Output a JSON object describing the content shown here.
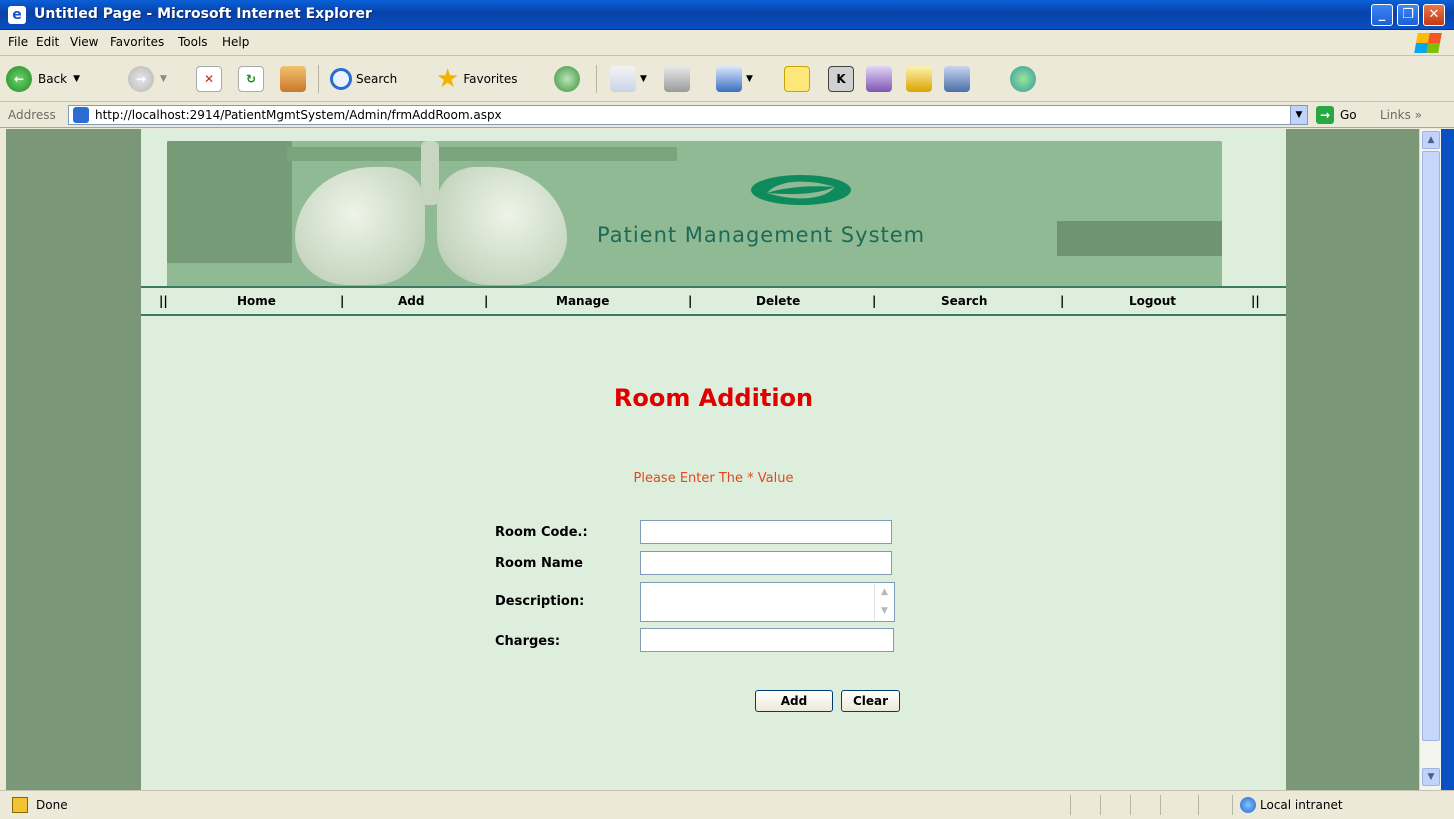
{
  "window": {
    "title": "Untitled Page - Microsoft Internet Explorer"
  },
  "menu": [
    "File",
    "Edit",
    "View",
    "Favorites",
    "Tools",
    "Help"
  ],
  "toolbar": {
    "back_label": "Back",
    "search_label": "Search",
    "favorites_label": "Favorites"
  },
  "address": {
    "label": "Address",
    "url": "http://localhost:2914/PatientMgmtSystem/Admin/frmAddRoom.aspx",
    "go_label": "Go",
    "links_label": "Links"
  },
  "banner": {
    "title": "Patient Management System"
  },
  "nav": {
    "sep_start": "||",
    "home": "Home",
    "add": "Add",
    "manage": "Manage",
    "delete": "Delete",
    "search": "Search",
    "logout": "Logout",
    "sep": "|",
    "sep_end": "||"
  },
  "page": {
    "heading": "Room Addition",
    "notice": "Please Enter The * Value",
    "fields": {
      "room_code": {
        "label": "Room Code.:",
        "value": ""
      },
      "room_name": {
        "label": "Room Name",
        "value": ""
      },
      "description": {
        "label": "Description:",
        "value": ""
      },
      "charges": {
        "label": "Charges:",
        "value": ""
      }
    },
    "buttons": {
      "add": "Add",
      "clear": "Clear"
    }
  },
  "status": {
    "text": "Done",
    "zone": "Local intranet"
  },
  "colors": {
    "heading": "#e00000",
    "notice": "#e04a1b",
    "page_bg": "#deeedd",
    "outer_bg": "#7a9877",
    "nav_border": "#3d7a60"
  }
}
